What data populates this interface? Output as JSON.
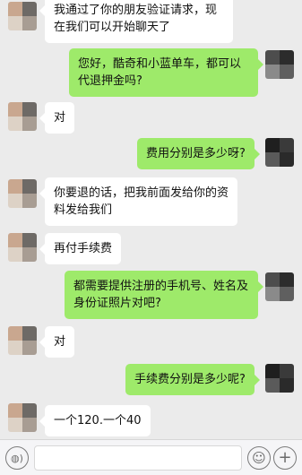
{
  "messages": [
    {
      "side": "left",
      "text": "我通过了你的朋友验证请求，现在我们可以开始聊天了"
    },
    {
      "side": "right",
      "text": "您好，酷奇和小蓝单车，都可以代退押金吗?"
    },
    {
      "side": "left",
      "text": "对"
    },
    {
      "side": "right",
      "text": "费用分别是多少呀?"
    },
    {
      "side": "left",
      "text": "你要退的话，把我前面发给你的资料发给我们"
    },
    {
      "side": "left",
      "text": "再付手续费"
    },
    {
      "side": "right",
      "text": "都需要提供注册的手机号、姓名及身份证照片对吧?"
    },
    {
      "side": "left",
      "text": "对"
    },
    {
      "side": "right",
      "text": "手续费分别是多少呢?"
    },
    {
      "side": "left",
      "text": "一个120.一个40"
    }
  ],
  "input_bar": {
    "voice_icon": "voice-icon",
    "voice_glyph": "◍)",
    "emoji_icon": "emoji-icon",
    "emoji_glyph": "☺",
    "plus_icon": "plus-icon",
    "plus_glyph": "+",
    "input_value": ""
  },
  "colors": {
    "background": "#ebebeb",
    "bubble_sent": "#9eea6a",
    "bubble_received": "#ffffff"
  }
}
